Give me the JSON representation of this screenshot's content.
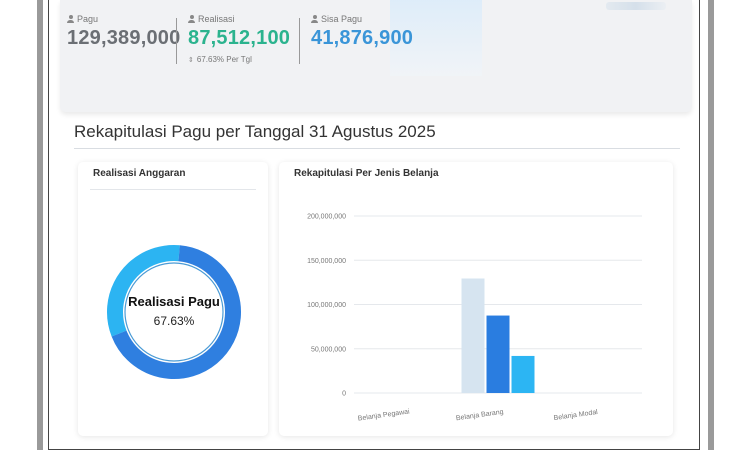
{
  "summary": {
    "pagu": {
      "label": "Pagu",
      "value": "129,389,000",
      "color": "#6b6f74",
      "icon": "user-icon"
    },
    "realisasi": {
      "label": "Realisasi",
      "value": "87,512,100",
      "color": "#2bb38e",
      "icon": "user-icon",
      "sub": "67.63% Per Tgl",
      "sub_icon": "sort-icon"
    },
    "sisa": {
      "label": "Sisa Pagu",
      "value": "41,876,900",
      "color": "#3a95d8",
      "icon": "user-icon"
    }
  },
  "section_title": "Rekapitulasi Pagu per Tanggal 31 Agustus 2025",
  "donut_card": {
    "title": "Realisasi Anggaran",
    "center_label": "Realisasi Pagu",
    "center_value": "67.63%",
    "percent": 67.63,
    "colors": {
      "realisasi": "#2f7fe0",
      "sisa": "#2cb4f2"
    }
  },
  "bar_card": {
    "title": "Rekapitulasi Per Jenis Belanja"
  },
  "chart_data": {
    "type": "bar",
    "categories": [
      "Belanja Pegawai",
      "Belanja Barang",
      "Belanja Modal"
    ],
    "series": [
      {
        "values": [
          0,
          129389000,
          0
        ],
        "color": "#d6e4f0"
      },
      {
        "values": [
          0,
          87512100,
          0
        ],
        "color": "#2a7de0"
      },
      {
        "values": [
          0,
          41876900,
          0
        ],
        "color": "#2cb5f3"
      }
    ],
    "y_ticks": [
      "0",
      "50,000,000",
      "100,000,000",
      "150,000,000",
      "200,000,000"
    ],
    "ylim": [
      0,
      200000000
    ],
    "grid": true
  }
}
